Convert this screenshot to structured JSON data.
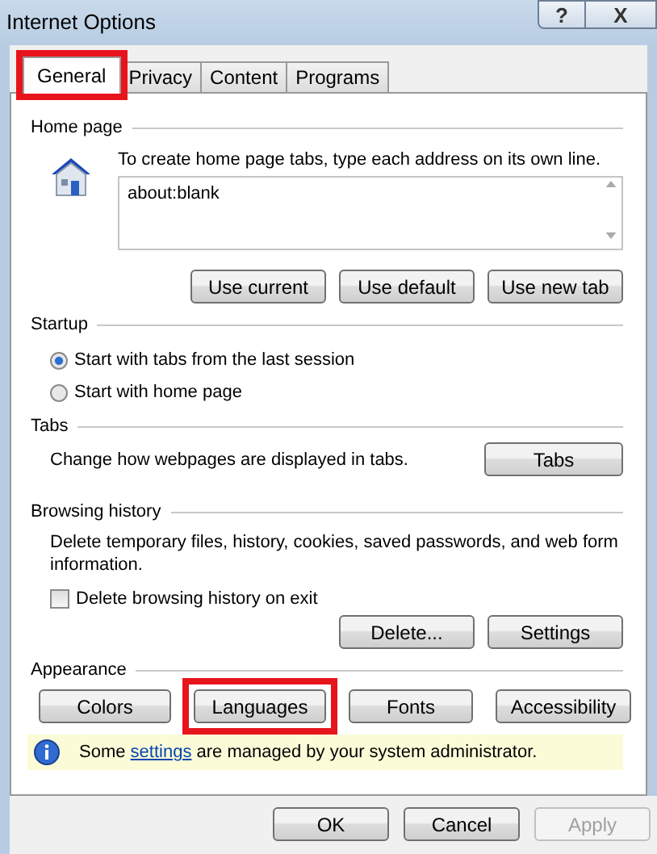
{
  "window": {
    "title": "Internet Options",
    "help_button": "?",
    "close_button": "X"
  },
  "tabs": [
    {
      "label": "General",
      "selected": true,
      "highlighted": true
    },
    {
      "label": "Privacy",
      "selected": false,
      "highlighted": false
    },
    {
      "label": "Content",
      "selected": false,
      "highlighted": false
    },
    {
      "label": "Programs",
      "selected": false,
      "highlighted": false
    }
  ],
  "home_page": {
    "heading": "Home page",
    "instruction": "To create home page tabs, type each address on its own line.",
    "value": "about:blank",
    "buttons": [
      "Use current",
      "Use default",
      "Use new tab"
    ]
  },
  "startup": {
    "heading": "Startup",
    "options": [
      {
        "label": "Start with tabs from the last session",
        "selected": true
      },
      {
        "label": "Start with home page",
        "selected": false
      }
    ]
  },
  "tabs_section": {
    "heading": "Tabs",
    "description": "Change how webpages are displayed in tabs.",
    "button": "Tabs"
  },
  "browsing_history": {
    "heading": "Browsing history",
    "description": "Delete temporary files, history, cookies, saved passwords, and web form information.",
    "checkbox": {
      "label": "Delete browsing history on exit",
      "checked": false
    },
    "buttons": [
      "Delete...",
      "Settings"
    ]
  },
  "appearance": {
    "heading": "Appearance",
    "buttons": [
      {
        "label": "Colors",
        "highlighted": false
      },
      {
        "label": "Languages",
        "highlighted": true
      },
      {
        "label": "Fonts",
        "highlighted": false
      },
      {
        "label": "Accessibility",
        "highlighted": false
      }
    ]
  },
  "notice": {
    "before": "Some",
    "link": "settings",
    "after": "are managed by your system administrator."
  },
  "dialog_buttons": [
    {
      "label": "OK",
      "disabled": false
    },
    {
      "label": "Cancel",
      "disabled": false
    },
    {
      "label": "Apply",
      "disabled": true
    }
  ]
}
